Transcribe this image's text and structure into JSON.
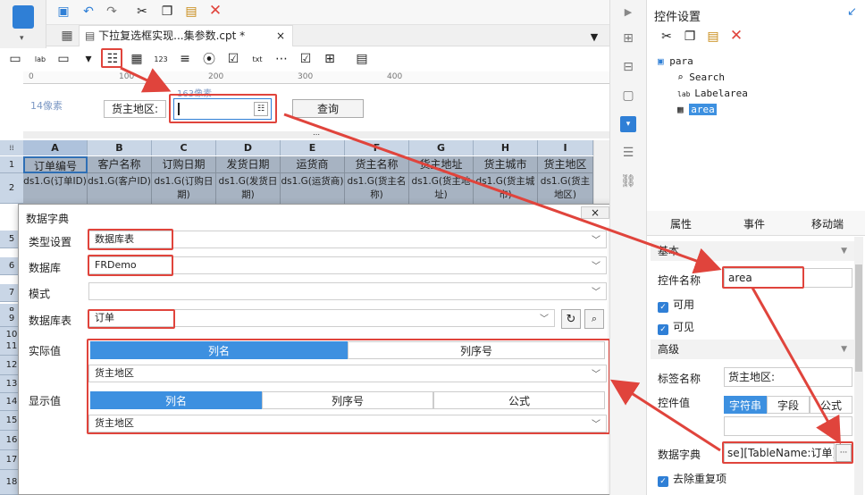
{
  "toolbar": {
    "file_tab_label": "下拉复选框实现...集参数.cpt *",
    "close_tab": "×"
  },
  "ruler": {
    "ticks": [
      "0",
      "100",
      "200",
      "300",
      "400"
    ]
  },
  "param_pane": {
    "size_hint_left": "14像素",
    "size_hint_top": "163像素",
    "label": "货主地区:",
    "query_button": "查询"
  },
  "sheet": {
    "columns": [
      "A",
      "B",
      "C",
      "D",
      "E",
      "F",
      "G",
      "H",
      "I"
    ],
    "row_numbers": [
      "1",
      "2",
      "",
      "",
      "5",
      "6",
      "7",
      "8",
      "9",
      "10",
      "11",
      "12",
      "13",
      "14",
      "15",
      "16",
      "17",
      "18"
    ],
    "headers": [
      "订单编号",
      "客户名称",
      "订购日期",
      "发货日期",
      "运货商",
      "货主名称",
      "货主地址",
      "货主城市",
      "货主地区"
    ],
    "data_cells": [
      "ds1.G(订单ID)",
      "ds1.G(客户ID)",
      "ds1.G(订购日期)",
      "ds1.G(发货日期)",
      "ds1.G(运货商)",
      "ds1.G(货主名称)",
      "ds1.G(货主地址)",
      "ds1.G(货主城市)",
      "ds1.G(货主地区)"
    ]
  },
  "dialog": {
    "title": "数据字典",
    "close": "×",
    "type_label": "类型设置",
    "type_value": "数据库表",
    "db_label": "数据库",
    "db_value": "FRDemo",
    "schema_label": "模式",
    "schema_value": "",
    "table_label": "数据库表",
    "table_value": "订单",
    "actual_label": "实际值",
    "actual_tabs": [
      "列名",
      "列序号"
    ],
    "actual_value": "货主地区",
    "display_label": "显示值",
    "display_tabs": [
      "列名",
      "列序号",
      "公式"
    ],
    "display_value": "货主地区"
  },
  "right_panel": {
    "title": "控件设置",
    "tree": {
      "root": "para",
      "items": [
        "Search",
        "Labelarea",
        "area"
      ]
    },
    "tabs": [
      "属性",
      "事件",
      "移动端"
    ],
    "section_basic": "基本",
    "name_label": "控件名称",
    "name_value": "area",
    "enabled_label": "可用",
    "visible_label": "可见",
    "section_advanced": "高级",
    "tag_label": "标签名称",
    "tag_value": "货主地区:",
    "value_label": "控件值",
    "value_tabs": [
      "字符串",
      "字段",
      "公式"
    ],
    "dict_label": "数据字典",
    "dict_value": "se][TableName:订单]",
    "dict_more": "···",
    "dedupe_label": "去除重复项"
  },
  "colors": {
    "accent": "#3d90e0",
    "highlight": "#e0443c"
  }
}
